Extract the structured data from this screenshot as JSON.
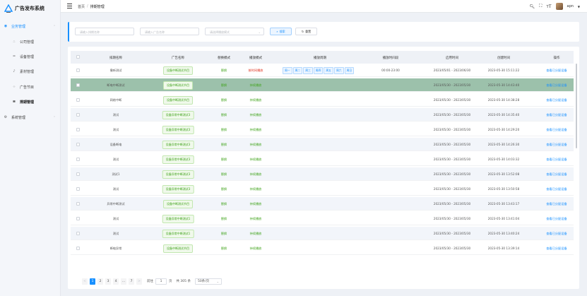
{
  "app": {
    "title": "广告发布系统"
  },
  "sidebar": {
    "items": [
      {
        "label": "业务管理",
        "icon": "briefcase-icon",
        "level": "top",
        "state": "active-parent",
        "expand": "^"
      },
      {
        "label": "公司管理",
        "icon": "org-icon",
        "level": "sub",
        "state": ""
      },
      {
        "label": "设备管理",
        "icon": "device-icon",
        "level": "sub",
        "state": ""
      },
      {
        "label": "素材管理",
        "icon": "music-icon",
        "level": "sub",
        "state": ""
      },
      {
        "label": "广告节目",
        "icon": "program-icon",
        "level": "sub",
        "state": ""
      },
      {
        "label": "排期管理",
        "icon": "schedule-icon",
        "level": "sub",
        "state": "active-sub"
      },
      {
        "label": "系统管理",
        "icon": "settings-icon",
        "level": "top",
        "state": "",
        "expand": "v"
      }
    ]
  },
  "header": {
    "breadcrumb": [
      "首页",
      "排期管理"
    ],
    "separator": "/",
    "user": "apn"
  },
  "search": {
    "schedule_name_placeholder": "请输入排期名称",
    "ad_name_placeholder": "请输入广告名称",
    "mode_placeholder": "请选择播放模式",
    "search_label": "搜索",
    "reset_label": "重置"
  },
  "table": {
    "columns": [
      "排期名称",
      "广告名称",
      "替换模式",
      "播放模式",
      "播放周期",
      "播放时间段",
      "启用时间",
      "创建时间",
      "操作"
    ],
    "rows": [
      {
        "name": "撤听测试",
        "ad": "设备中断测试节目",
        "replace": "替换",
        "mode": "按时间播放",
        "mode_color": "red",
        "days": [
          "周一",
          "周二",
          "周三",
          "周四",
          "周五",
          "周六",
          "周日"
        ],
        "period": "00:00-23:00",
        "enable": "2023/05/01 - 2023/06/30",
        "created": "2023-05-30 15:11:22",
        "op": "查看已分配设备"
      },
      {
        "name": "断电中断测试",
        "ad": "设备中断测试节目",
        "replace": "替换",
        "mode": "持续播放",
        "mode_color": "green",
        "days": [],
        "period": "",
        "enable": "2023/05/30 - 2023/05/30",
        "created": "2023-05-30 14:43:40",
        "op": "查看已分配设备",
        "highlight": true
      },
      {
        "name": "网络中断",
        "ad": "设备中断测试节目",
        "replace": "替换",
        "mode": "持续播放",
        "mode_color": "green",
        "days": [],
        "period": "",
        "enable": "2023/05/30 - 2023/05/30",
        "created": "2023-05-30 14:38:28",
        "op": "查看已分配设备"
      },
      {
        "name": "测试",
        "ad": "设备异常中断测试3",
        "replace": "替换",
        "mode": "持续播放",
        "mode_color": "green",
        "days": [],
        "period": "",
        "enable": "2023/05/30 - 2023/05/30",
        "created": "2023-05-30 14:35:40",
        "op": "查看已分配设备"
      },
      {
        "name": "测试",
        "ad": "设备异常中断测试3",
        "replace": "替换",
        "mode": "持续播放",
        "mode_color": "green",
        "days": [],
        "period": "",
        "enable": "2023/05/30 - 2023/05/30",
        "created": "2023-05-30 14:29:20",
        "op": "查看已分配设备"
      },
      {
        "name": "设备断电",
        "ad": "设备异常中断测试3",
        "replace": "替换",
        "mode": "持续播放",
        "mode_color": "green",
        "days": [],
        "period": "",
        "enable": "2023/05/30 - 2023/05/30",
        "created": "2023-05-30 14:26:30",
        "op": "查看已分配设备"
      },
      {
        "name": "测试",
        "ad": "设备异常中断测试3",
        "replace": "替换",
        "mode": "持续播放",
        "mode_color": "green",
        "days": [],
        "period": "",
        "enable": "2023/05/30 - 2023/05/30",
        "created": "2023-05-30 14:03:32",
        "op": "查看已分配设备"
      },
      {
        "name": "测试1",
        "ad": "设备异常中断测试3",
        "replace": "替换",
        "mode": "持续播放",
        "mode_color": "green",
        "days": [],
        "period": "",
        "enable": "2023/05/30 - 2023/05/30",
        "created": "2023-05-30 13:52:08",
        "op": "查看已分配设备"
      },
      {
        "name": "测试",
        "ad": "设备异常中断测试3",
        "replace": "替换",
        "mode": "持续播放",
        "mode_color": "green",
        "days": [],
        "period": "",
        "enable": "2023/05/30 - 2023/05/30",
        "created": "2023-05-30 13:50:58",
        "op": "查看已分配设备"
      },
      {
        "name": "异常中断测试",
        "ad": "设备中断测试节目",
        "replace": "替换",
        "mode": "持续播放",
        "mode_color": "green",
        "days": [],
        "period": "",
        "enable": "2023/05/30 - 2023/05/30",
        "created": "2023-05-30 13:43:17",
        "op": "查看已分配设备"
      },
      {
        "name": "测试",
        "ad": "设备异常中断测试1",
        "replace": "替换",
        "mode": "持续播放",
        "mode_color": "green",
        "days": [],
        "period": "",
        "enable": "2023/05/30 - 2023/05/30",
        "created": "2023-05-30 13:41:04",
        "op": "查看已分配设备"
      },
      {
        "name": "测试",
        "ad": "设备异常中断测试1",
        "replace": "替换",
        "mode": "持续播放",
        "mode_color": "green",
        "days": [],
        "period": "",
        "enable": "2023/05/30 - 2023/05/30",
        "created": "2023-05-30 13:40:24",
        "op": "查看已分配设备"
      },
      {
        "name": "断电异常",
        "ad": "设备中断测试节目",
        "replace": "替换",
        "mode": "持续播放",
        "mode_color": "green",
        "days": [],
        "period": "",
        "enable": "2023/05/30 - 2023/05/30",
        "created": "2023-05-30 13:39:14",
        "op": "查看已分配设备"
      }
    ]
  },
  "pagination": {
    "pages": [
      "1",
      "2",
      "3",
      "4",
      "...",
      "7"
    ],
    "current": "1",
    "prev": "<",
    "next": ">",
    "goto_label": "前往",
    "goto_value": "1",
    "page_unit": "页",
    "total": "共 305 条",
    "page_size": "50条/页"
  },
  "colors": {
    "accent": "#1890ff",
    "green": "#3fa31a",
    "red": "#e0301e",
    "highlight_row": "#9cc1ab"
  }
}
